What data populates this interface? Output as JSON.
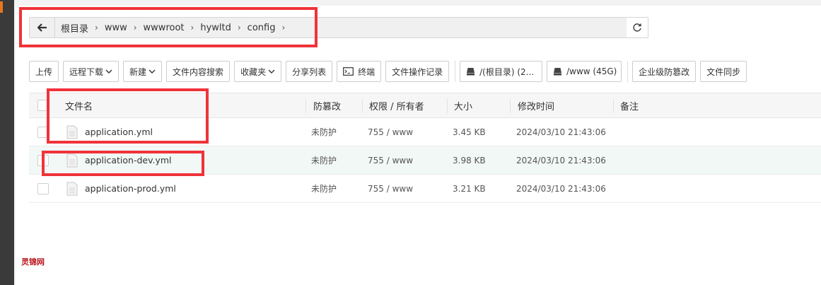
{
  "breadcrumb": {
    "items": [
      "根目录",
      "www",
      "wwwroot",
      "hywltd",
      "config"
    ]
  },
  "toolbar": {
    "upload": "上传",
    "remote_download": "远程下载",
    "new": "新建",
    "content_search": "文件内容搜索",
    "favorites": "收藏夹",
    "share_list": "分享列表",
    "terminal": "终端",
    "op_log": "文件操作记录",
    "disk_root": "/(根目录) (2...",
    "disk_www": "/www (45G)",
    "tamper_proof": "企业级防篡改",
    "file_sync": "文件同步"
  },
  "table": {
    "headers": {
      "name": "文件名",
      "protect": "防篡改",
      "perm": "权限 / 所有者",
      "size": "大小",
      "mtime": "修改时间",
      "note": "备注"
    },
    "rows": [
      {
        "name": "application.yml",
        "protect": "未防护",
        "perm": "755 / www",
        "size": "3.45 KB",
        "mtime": "2024/03/10 21:43:06"
      },
      {
        "name": "application-dev.yml",
        "protect": "未防护",
        "perm": "755 / www",
        "size": "3.98 KB",
        "mtime": "2024/03/10 21:43:06"
      },
      {
        "name": "application-prod.yml",
        "protect": "未防护",
        "perm": "755 / www",
        "size": "3.21 KB",
        "mtime": "2024/03/10 21:43:06"
      }
    ]
  },
  "watermark": "灵锦网",
  "colors": {
    "annotation_red": "#f0333a",
    "hover_row": "#f2f8f6"
  }
}
